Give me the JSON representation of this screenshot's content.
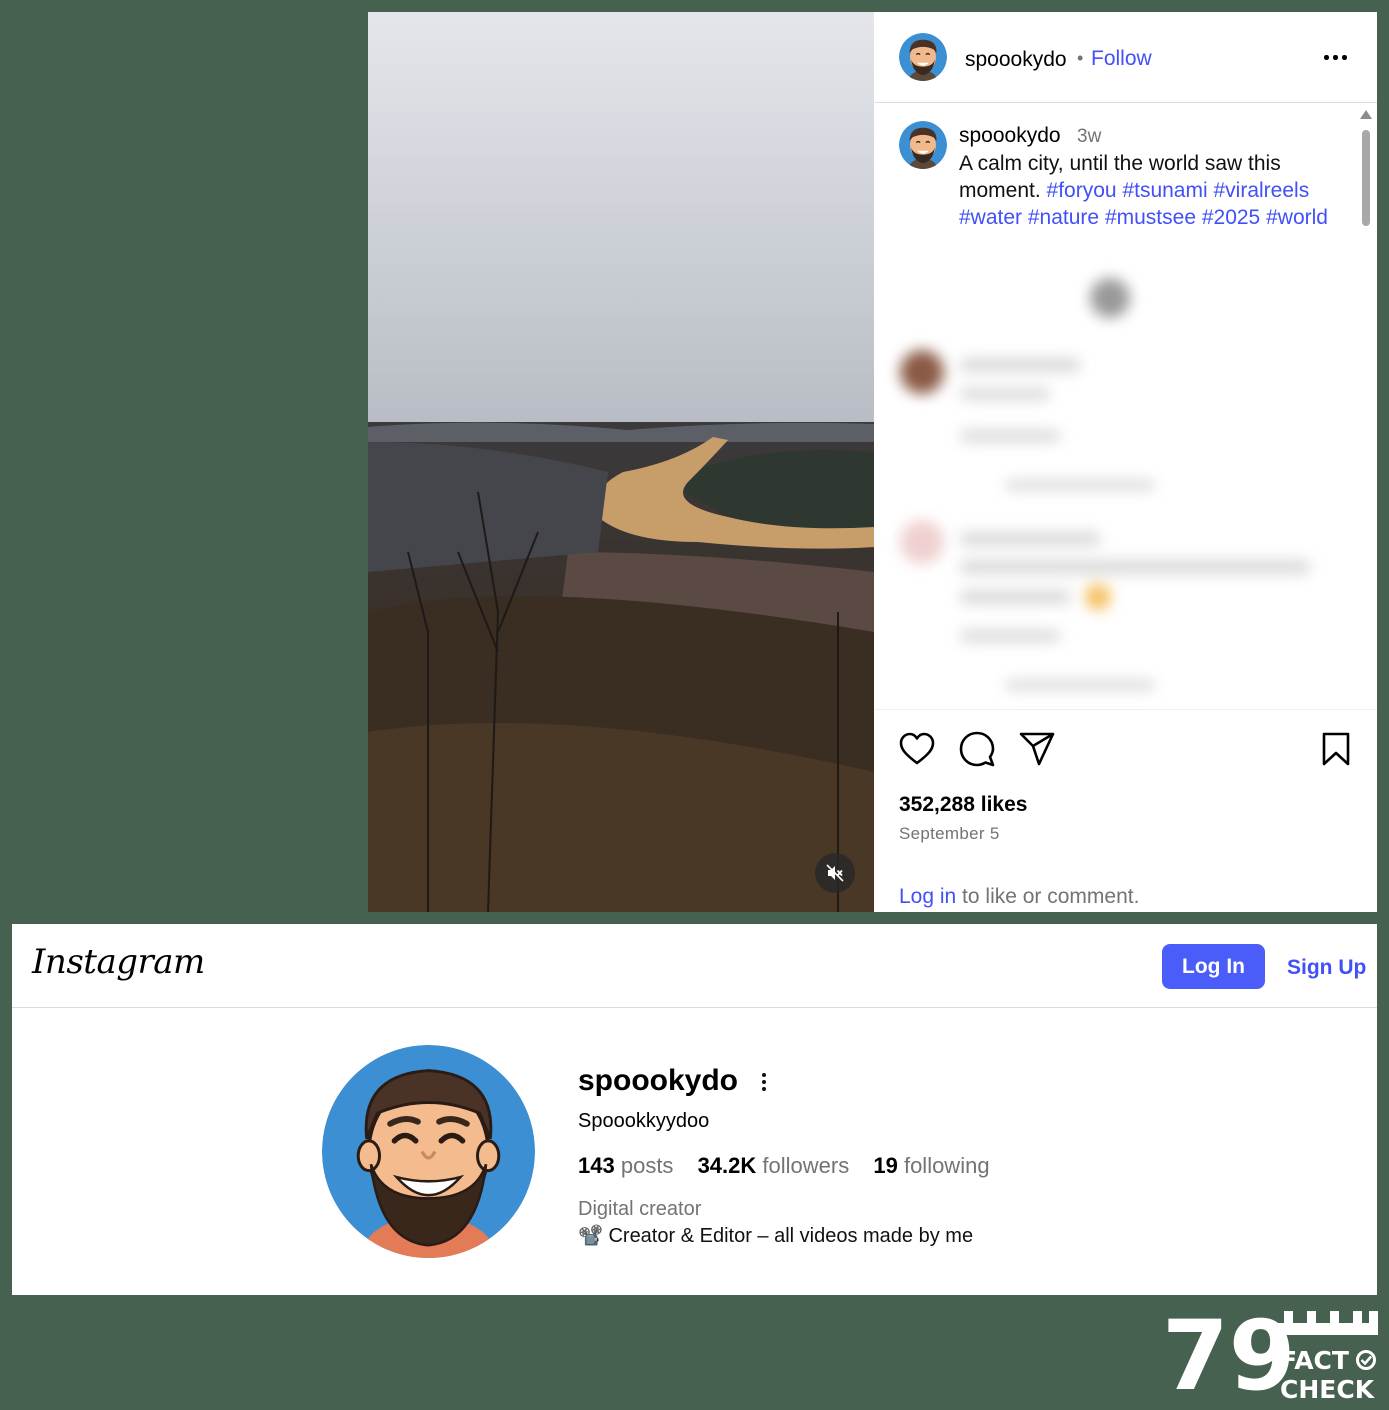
{
  "post": {
    "username": "spoookydo",
    "separator": "•",
    "follow_label": "Follow",
    "caption": {
      "username": "spoookydo",
      "time": "3w",
      "text": "A calm city, until the world saw this moment.",
      "hashtags": [
        "#foryou",
        "#tsunami",
        "#viralreels",
        "#water",
        "#nature",
        "#mustsee",
        "#2025",
        "#world"
      ]
    },
    "likes": "352,288 likes",
    "date": "September 5",
    "login_link": "Log in",
    "login_suffix": " to like or comment."
  },
  "profile": {
    "logo": "Instagram",
    "login_button": "Log In",
    "signup_link": "Sign Up",
    "username": "spoookydo",
    "full_name": "Spoookkyydoo",
    "stats": [
      {
        "count": "143",
        "label": "posts"
      },
      {
        "count": "34.2K",
        "label": "followers"
      },
      {
        "count": "19",
        "label": "following"
      }
    ],
    "category": "Digital creator",
    "bio": "📽️ Creator & Editor – all videos made by me"
  },
  "badge": {
    "number": "79",
    "line1": "FACT",
    "line2": "CHECK"
  },
  "colors": {
    "background": "#466150",
    "link_blue": "#4150f7",
    "button_blue": "#4a5df9",
    "muted": "#737373"
  },
  "icons": [
    "volume-muted-icon",
    "more-options-icon",
    "heart-icon",
    "comment-icon",
    "share-icon",
    "bookmark-icon",
    "kebab-icon",
    "checkmark-icon"
  ]
}
